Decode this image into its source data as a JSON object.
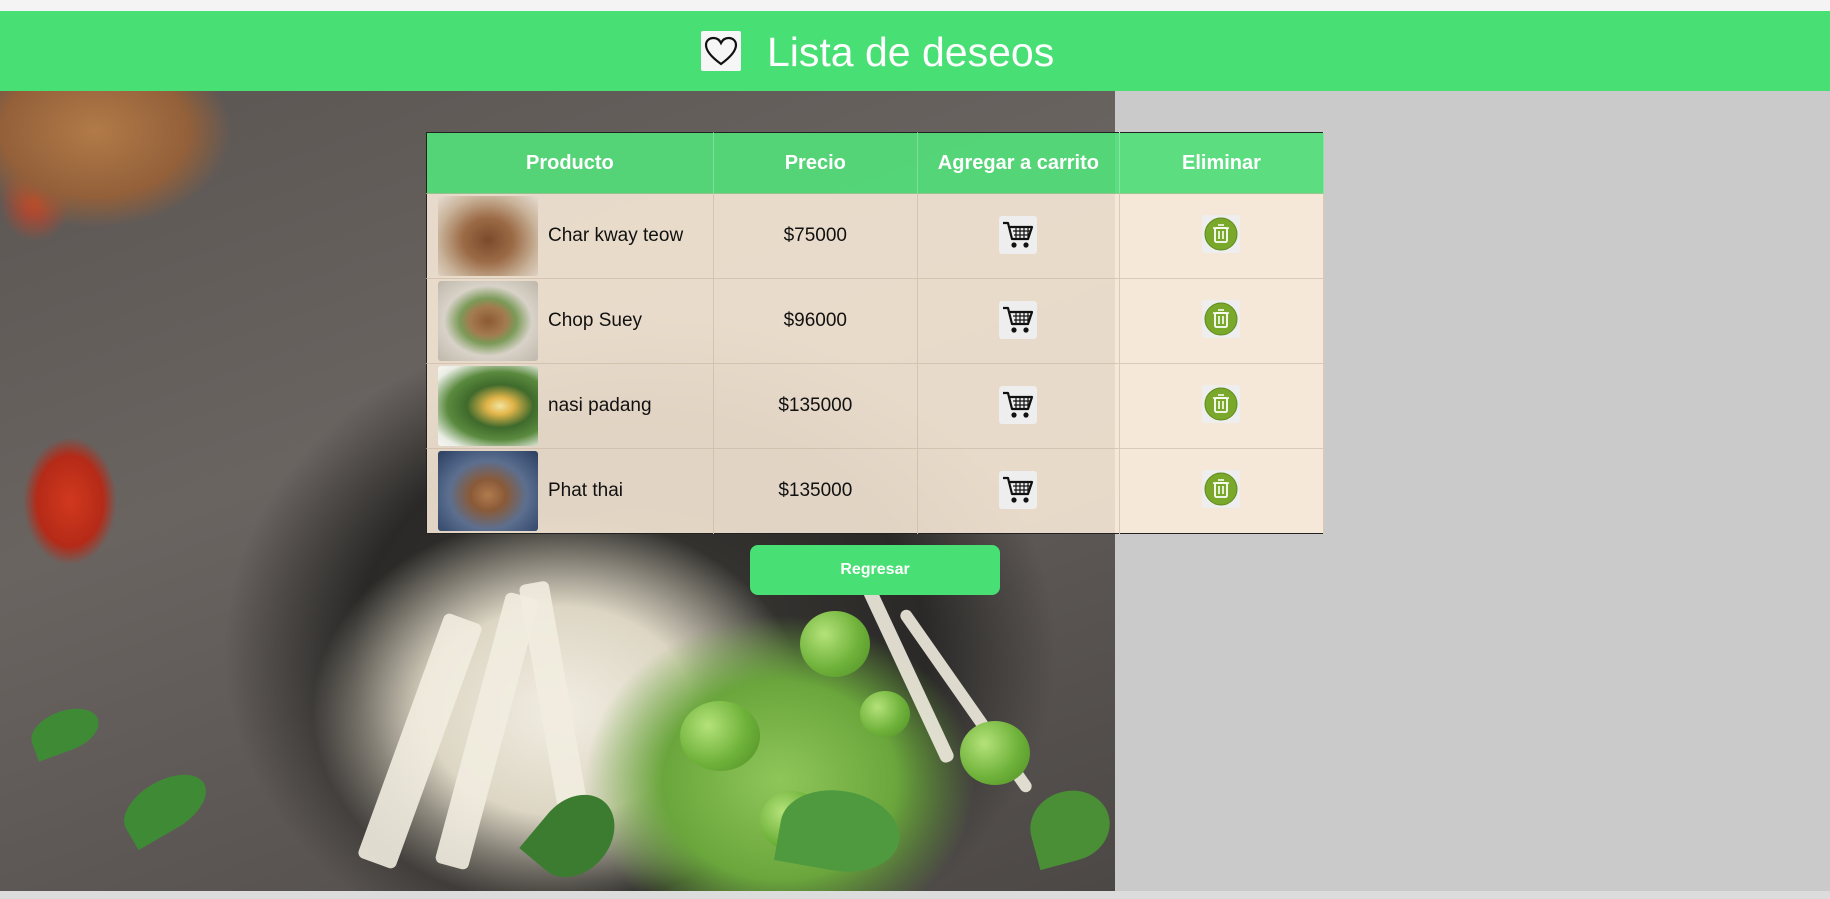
{
  "header": {
    "title": "Lista de deseos",
    "icon": "heart-icon",
    "background_color": "#48e074"
  },
  "table": {
    "columns": [
      "Producto",
      "Precio",
      "Agregar a carrito",
      "Eliminar"
    ],
    "rows": [
      {
        "product": "Char kway teow",
        "price": "$75000"
      },
      {
        "product": "Chop Suey",
        "price": "$96000"
      },
      {
        "product": "nasi padang",
        "price": "$135000"
      },
      {
        "product": "Phat thai",
        "price": "$135000"
      }
    ],
    "cart_icon": "shopping-cart-icon",
    "delete_icon": "trash-icon"
  },
  "back_button": {
    "label": "Regresar"
  }
}
